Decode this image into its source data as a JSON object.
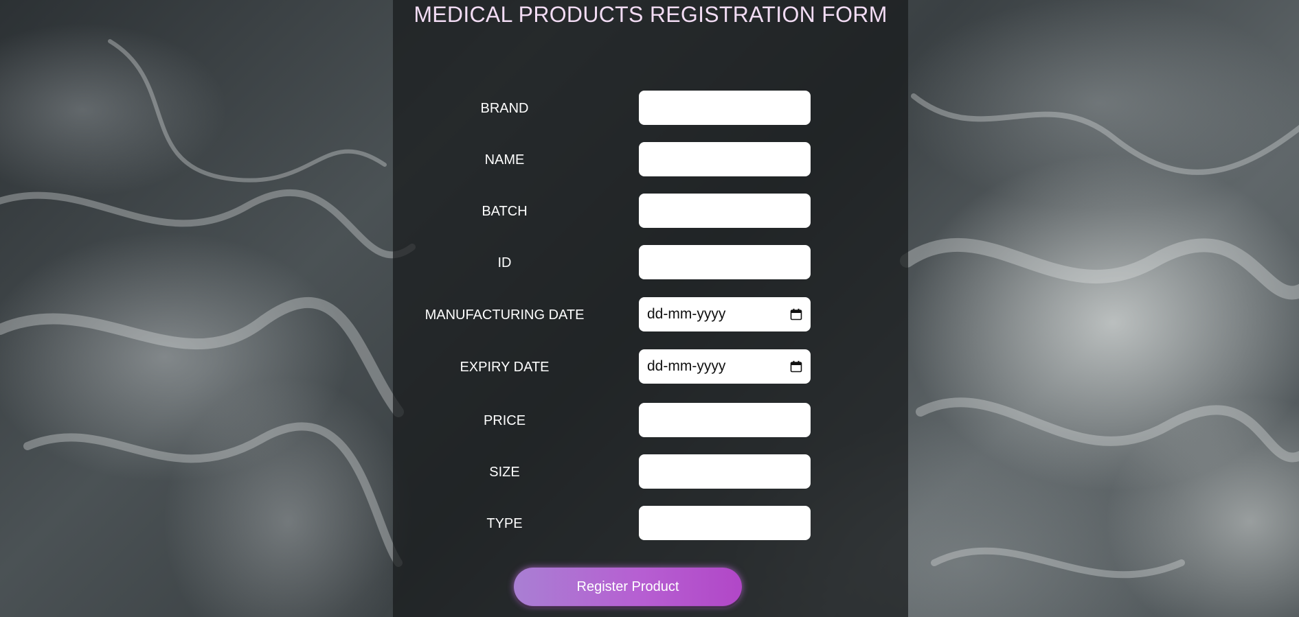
{
  "form": {
    "title": "MEDICAL PRODUCTS REGISTRATION FORM",
    "fields": [
      {
        "label": "BRAND",
        "type": "text",
        "value": ""
      },
      {
        "label": "NAME",
        "type": "text",
        "value": ""
      },
      {
        "label": "BATCH",
        "type": "text",
        "value": ""
      },
      {
        "label": "ID",
        "type": "text",
        "value": ""
      },
      {
        "label": "MANUFACTURING DATE",
        "type": "date",
        "placeholder": "dd-mm-yyyy"
      },
      {
        "label": "EXPIRY DATE",
        "type": "date",
        "placeholder": "dd-mm-yyyy"
      },
      {
        "label": "PRICE",
        "type": "text",
        "value": ""
      },
      {
        "label": "SIZE",
        "type": "text",
        "value": ""
      },
      {
        "label": "TYPE",
        "type": "text",
        "value": ""
      }
    ],
    "submit_label": "Register Product"
  },
  "colors": {
    "title": "#f2dcf4",
    "button_gradient_start": "#a97fd3",
    "button_gradient_end": "#b147c7",
    "panel": "#181a1c"
  },
  "icons": {
    "date_picker": "calendar-icon"
  }
}
